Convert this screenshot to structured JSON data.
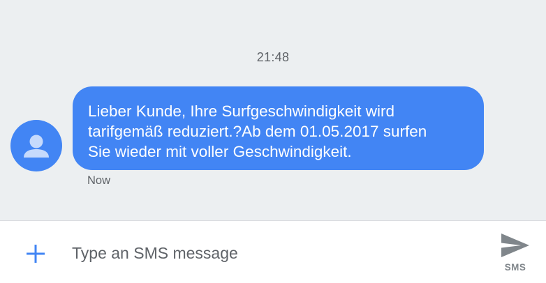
{
  "conversation": {
    "timestamp": "21:48",
    "messages": [
      {
        "sender_avatar": "person-icon",
        "text": "Lieber Kunde, Ihre Surfgeschwindigkeit wird\ntarifgemäß reduziert.?Ab dem 01.05.2017 surfen\nSie wieder mit voller Geschwindigkeit.",
        "status": "Now"
      }
    ]
  },
  "compose": {
    "attach_icon": "plus-icon",
    "placeholder": "Type an SMS message",
    "value": "",
    "send_icon": "send-icon",
    "send_label": "SMS"
  },
  "colors": {
    "accent": "#4285f4",
    "conversation_background": "#eceff1",
    "bubble_text": "#ffffff",
    "secondary_text": "#5f6368",
    "send_icon": "#80868b"
  }
}
